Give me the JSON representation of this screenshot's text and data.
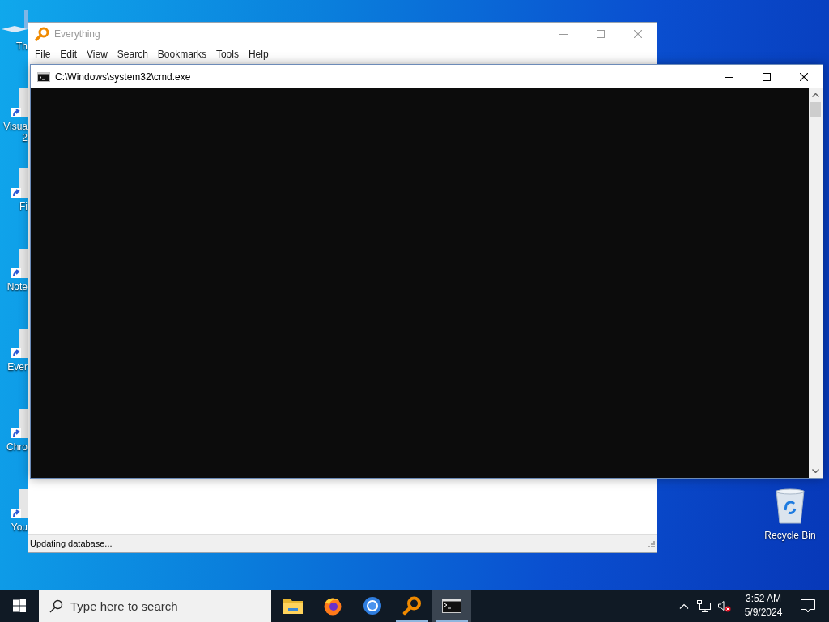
{
  "desktop": {
    "icons": [
      {
        "kind": "computer",
        "lines": [
          "Th"
        ]
      },
      {
        "kind": "shortcut",
        "lines": [
          "Visua",
          "2"
        ]
      },
      {
        "kind": "shortcut",
        "lines": [
          "Fi"
        ]
      },
      {
        "kind": "shortcut",
        "lines": [
          "Note"
        ]
      },
      {
        "kind": "shortcut",
        "lines": [
          "Ever"
        ]
      },
      {
        "kind": "shortcut",
        "lines": [
          "Chro"
        ]
      },
      {
        "kind": "shortcut",
        "lines": [
          "You"
        ]
      }
    ],
    "recycle_bin": {
      "label": "Recycle Bin"
    }
  },
  "windows": [
    {
      "kind": "everything",
      "title": "Everything",
      "menu": [
        "File",
        "Edit",
        "View",
        "Search",
        "Bookmarks",
        "Tools",
        "Help"
      ],
      "status": "Updating database..."
    },
    {
      "kind": "console",
      "title": "C:\\Windows\\system32\\cmd.exe"
    }
  ],
  "taskbar": {
    "search": {
      "placeholder": "Type here to search"
    },
    "apps": [
      {
        "kind": "folder",
        "selected": false,
        "running": false
      },
      {
        "kind": "firefox",
        "selected": false,
        "running": false
      },
      {
        "kind": "chromium",
        "selected": false,
        "running": false
      },
      {
        "kind": "magnifier",
        "selected": false,
        "running": true
      },
      {
        "kind": "console",
        "selected": true,
        "running": true
      }
    ],
    "clock": {
      "time": "3:52 AM",
      "date": "5/9/2024"
    }
  }
}
